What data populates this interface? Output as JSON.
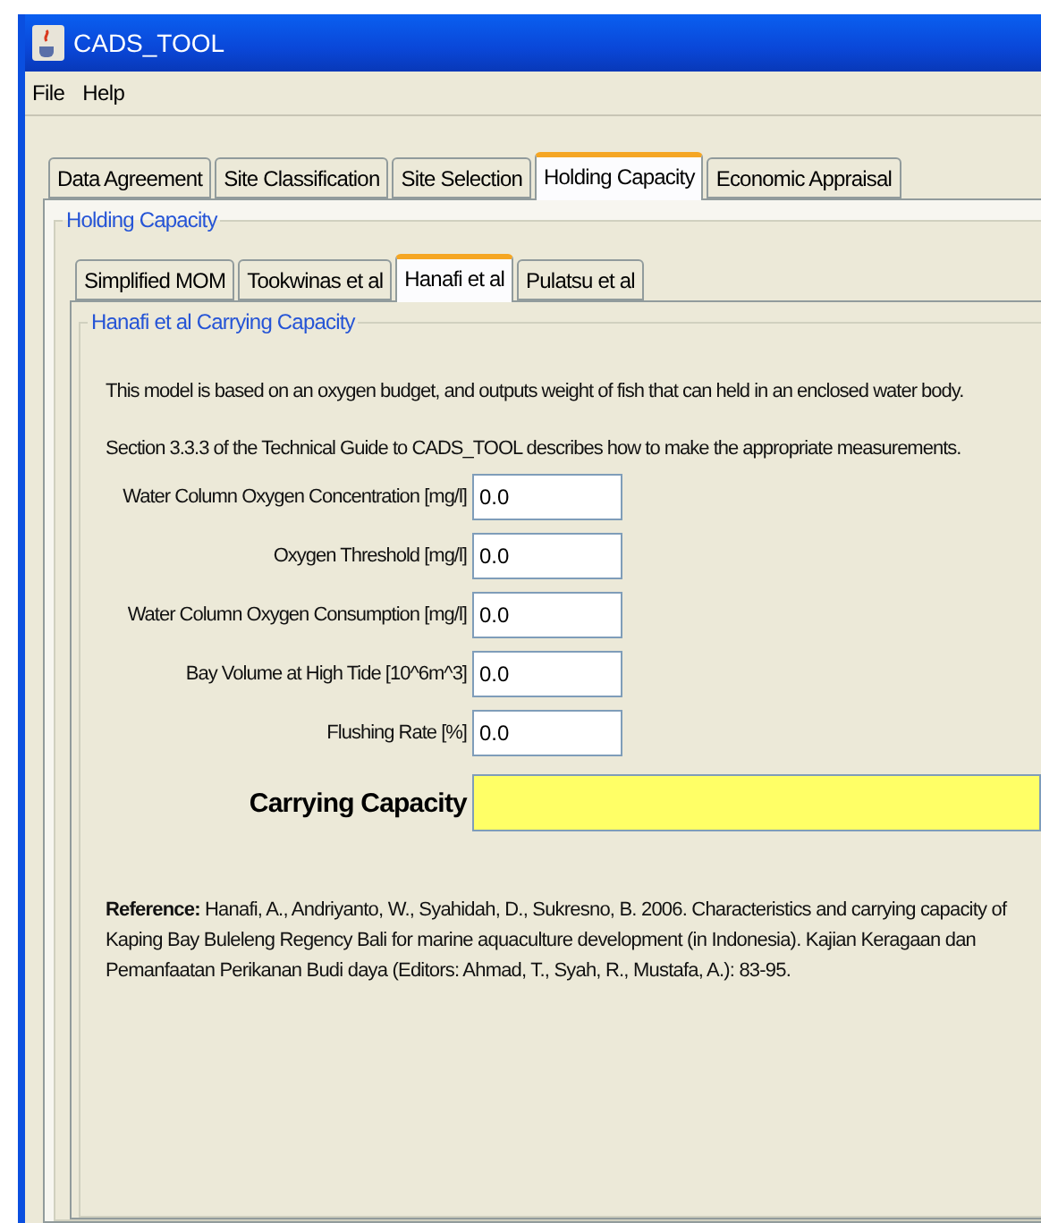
{
  "window": {
    "title": "CADS_TOOL"
  },
  "menu": [
    "File",
    "Help"
  ],
  "tabs": [
    {
      "label": "Data Agreement",
      "selected": false
    },
    {
      "label": "Site Classification",
      "selected": false
    },
    {
      "label": "Site Selection",
      "selected": false
    },
    {
      "label": "Holding Capacity",
      "selected": true
    },
    {
      "label": "Economic Appraisal",
      "selected": false
    }
  ],
  "group_title": "Holding Capacity",
  "subtabs": [
    {
      "label": "Simplified MOM",
      "selected": false
    },
    {
      "label": "Tookwinas et al",
      "selected": false
    },
    {
      "label": "Hanafi et al",
      "selected": true
    },
    {
      "label": "Pulatsu et al",
      "selected": false
    }
  ],
  "subgroup_title": "Hanafi et al Carrying Capacity",
  "description": "This model is based on an oxygen budget, and outputs weight of fish that can held in an enclosed water body.",
  "section_note": "Section 3.3.3 of the Technical Guide to CADS_TOOL describes how to make the appropriate measurements.",
  "fields": [
    {
      "label": "Water Column Oxygen Concentration [mg/l]",
      "value": "0.0"
    },
    {
      "label": "Oxygen Threshold [mg/l]",
      "value": "0.0"
    },
    {
      "label": "Water Column Oxygen Consumption [mg/l]",
      "value": "0.0"
    },
    {
      "label": "Bay Volume at High Tide [10^6m^3]",
      "value": "0.0"
    },
    {
      "label": "Flushing Rate [%]",
      "value": "0.0"
    }
  ],
  "result": {
    "label": "Carrying Capacity"
  },
  "reference": "**Reference:** Hanafi, A., Andriyanto, W., Syahidah, D., Sukresno, B. 2006. Characteristics and carrying capacity of Kaping Bay Buleleng Regency Bali for marine aquaculture development (in Indonesia). Kajian Keragaan dan Pemanfaatan Perikanan Budi daya (Editors: Ahmad, T., Syah, R., Mustafa, A.): 83-95."
}
